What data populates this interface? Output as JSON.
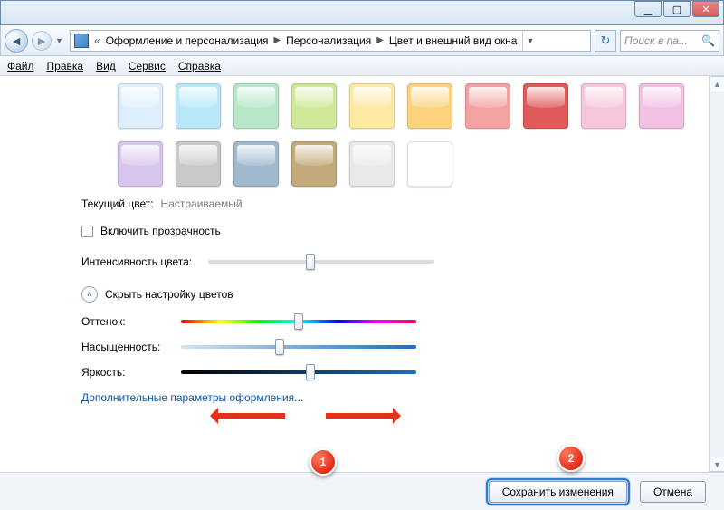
{
  "window": {
    "breadcrumbs": [
      "Оформление и персонализация",
      "Персонализация",
      "Цвет и внешний вид окна"
    ],
    "search_placeholder": "Поиск в па..."
  },
  "menu": {
    "file": "Файл",
    "edit": "Правка",
    "view": "Вид",
    "tools": "Сервис",
    "help": "Справка"
  },
  "colors_row1": [
    "#dfeefc",
    "#b8e8f7",
    "#b7e6c9",
    "#cfe89a",
    "#fde9a1",
    "#fbd37e",
    "#f3a2a2",
    "#e05a5a"
  ],
  "colors_row2": [
    "#f6c6dc",
    "#f1c0e3",
    "#d9c6ee",
    "#c9c9c9",
    "#9fb9cf",
    "#c4a97a",
    "#e9e9e9",
    "#ffffff"
  ],
  "labels": {
    "current_color": "Текущий цвет:",
    "current_color_value": "Настраиваемый",
    "transparency": "Включить прозрачность",
    "intensity": "Интенсивность цвета:",
    "mixer_toggle": "Скрыть настройку цветов",
    "hue": "Оттенок:",
    "saturation": "Насыщенность:",
    "brightness": "Яркость:",
    "advanced_link": "Дополнительные параметры оформления..."
  },
  "slider_positions": {
    "intensity_pct": 45,
    "hue_pct": 50,
    "saturation_pct": 42,
    "brightness_pct": 55
  },
  "buttons": {
    "save": "Сохранить изменения",
    "cancel": "Отмена"
  },
  "annotations": {
    "badge1": "1",
    "badge2": "2"
  }
}
